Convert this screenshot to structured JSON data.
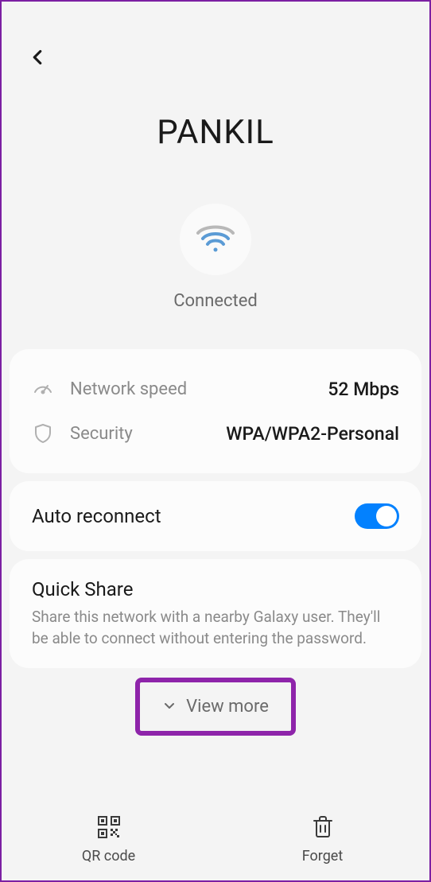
{
  "network": {
    "name": "PANKIL",
    "status": "Connected"
  },
  "info": {
    "speed_label": "Network speed",
    "speed_value": "52 Mbps",
    "security_label": "Security",
    "security_value": "WPA/WPA2-Personal"
  },
  "auto_reconnect": {
    "label": "Auto reconnect",
    "enabled": true
  },
  "quick_share": {
    "title": "Quick Share",
    "description": "Share this network with a nearby Galaxy user. They'll be able to connect without entering the password."
  },
  "view_more": {
    "label": "View more"
  },
  "bottom": {
    "qr_label": "QR code",
    "forget_label": "Forget"
  }
}
